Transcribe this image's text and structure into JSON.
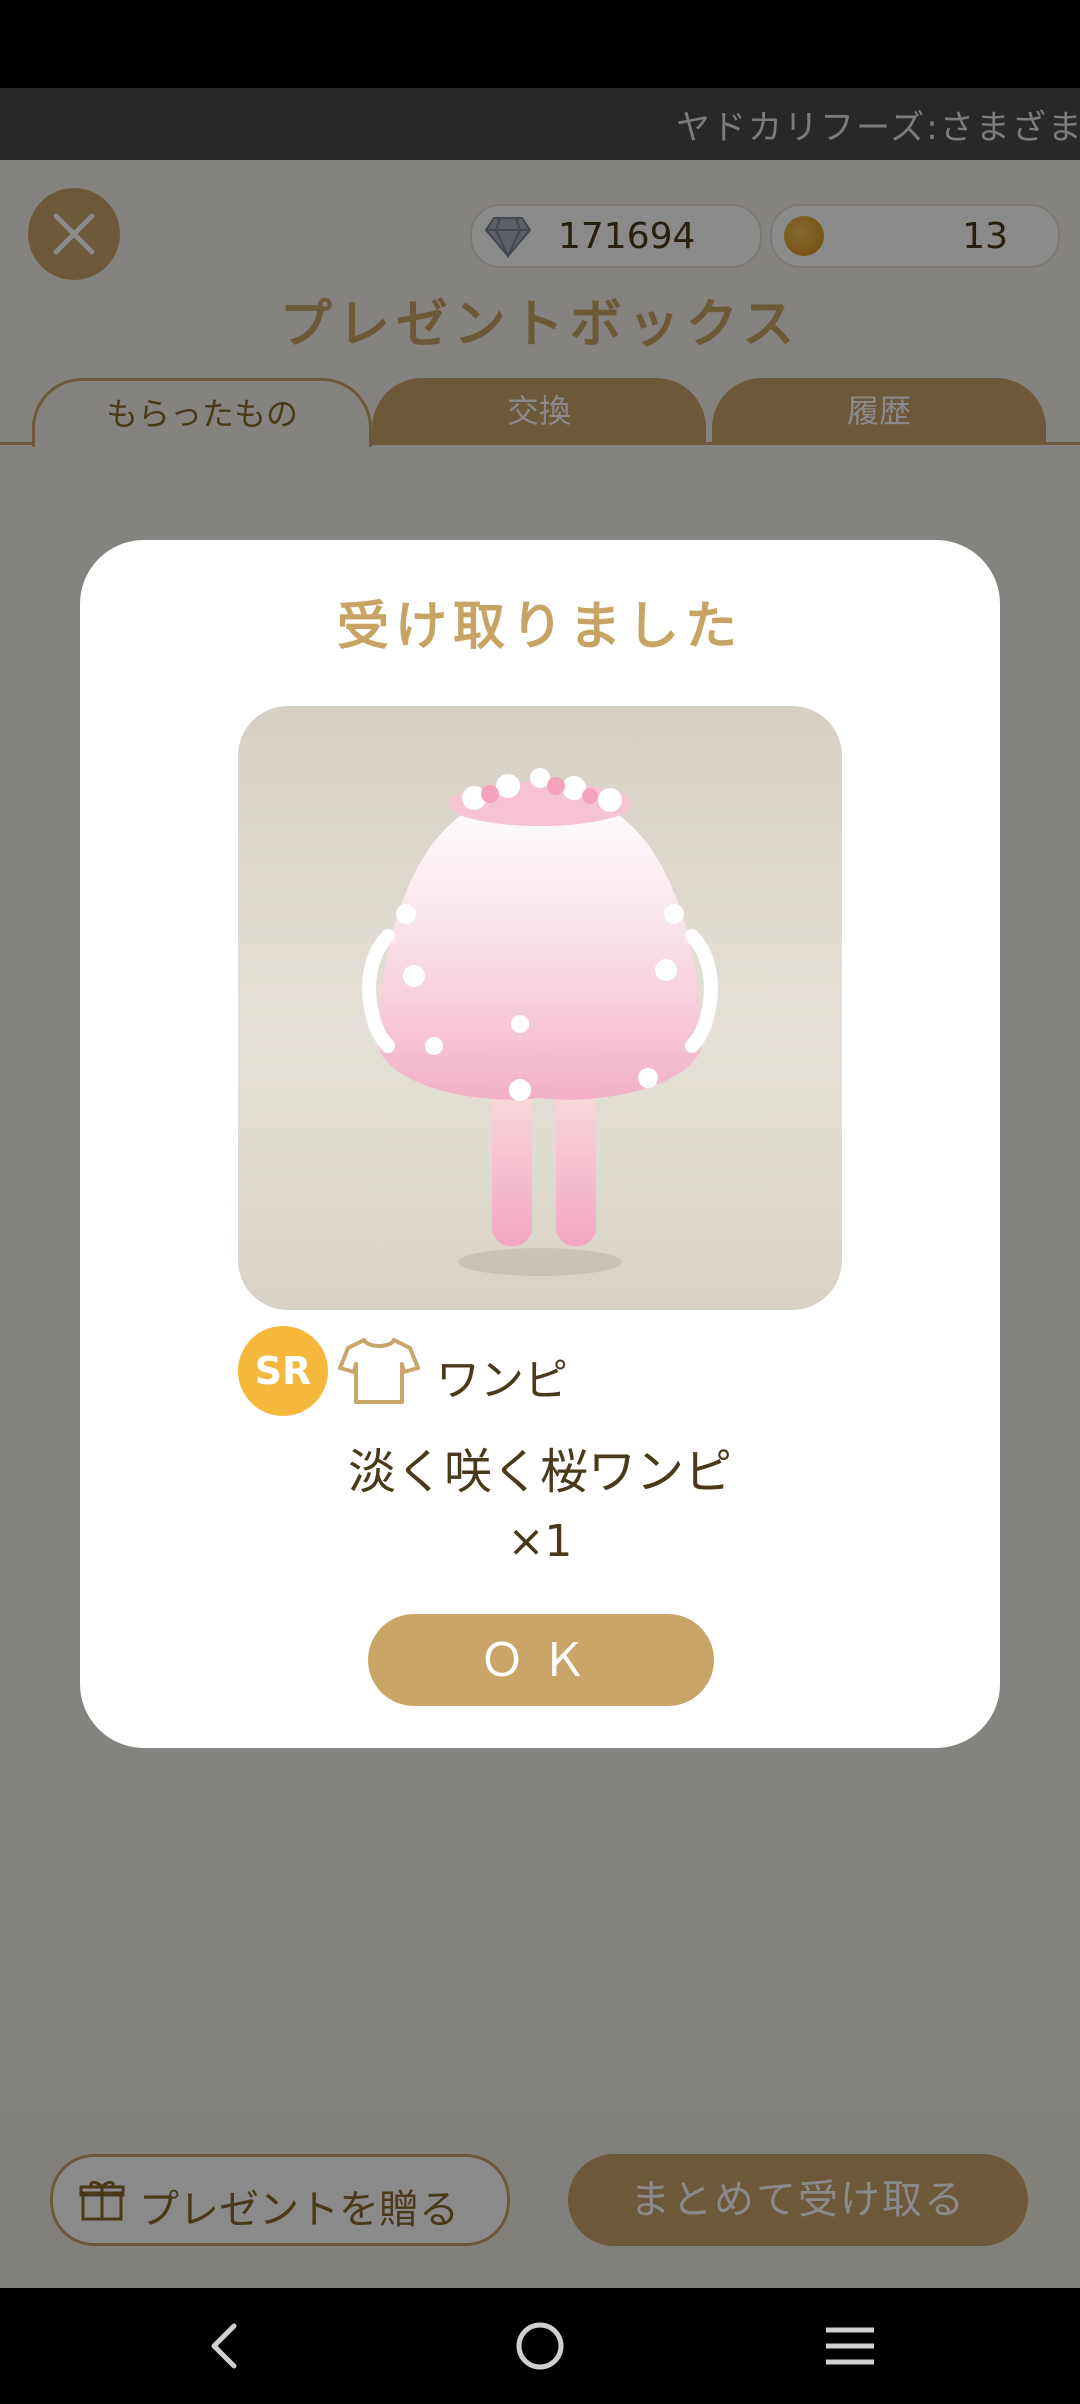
{
  "ticker": {
    "text": "ヤドカリフーズ:さまざまな"
  },
  "currency": {
    "gems": "171694",
    "coins": "13"
  },
  "page_title": "プレゼントボックス",
  "tabs": [
    {
      "label": "もらったもの"
    },
    {
      "label": "交換"
    },
    {
      "label": "履歴"
    }
  ],
  "bottom": {
    "send_gift_label": "プレゼントを贈る",
    "receive_all_label": "まとめて受け取る"
  },
  "modal": {
    "title": "受け取りました",
    "rarity": "SR",
    "category": "ワンピ",
    "item_name": "淡く咲く桜ワンピ",
    "quantity": "×1",
    "ok_label": "ＯＫ"
  },
  "icons": {
    "close": "close-icon",
    "gem": "diamond-icon",
    "coin": "coin-icon",
    "gift": "gift-icon",
    "category": "shirt-icon",
    "nav": [
      "back-icon",
      "home-icon",
      "menu-icon"
    ]
  },
  "colors": {
    "accent": "#c9a56a",
    "title": "#c8a464",
    "rarity": "#f6b83a",
    "text": "#4a3a1c"
  }
}
